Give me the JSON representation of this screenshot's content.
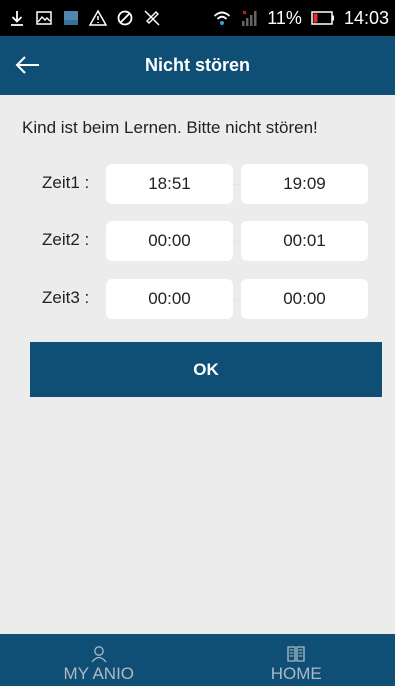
{
  "status": {
    "battery": "11%",
    "time": "14:03",
    "icons": [
      "download-icon",
      "image-icon",
      "app-icon",
      "warning-icon",
      "data-saver-icon",
      "mute-icon",
      "wifi-icon",
      "signal-icon",
      "battery-icon"
    ]
  },
  "header": {
    "title": "Nicht stören",
    "back_icon": "arrow-left-icon"
  },
  "message": "Kind ist beim Lernen. Bitte nicht stören!",
  "rows": [
    {
      "label": "Zeit1 :",
      "start": "18:51",
      "end": "19:09"
    },
    {
      "label": "Zeit2 :",
      "start": "00:00",
      "end": "00:01"
    },
    {
      "label": "Zeit3 :",
      "start": "00:00",
      "end": "00:00"
    }
  ],
  "ok_label": "OK",
  "nav": [
    {
      "label": "MY ANIO",
      "icon": "person-icon"
    },
    {
      "label": "HOME",
      "icon": "book-icon"
    }
  ],
  "colors": {
    "primary": "#0f4f75",
    "background": "#ececec",
    "nav_text": "#aeb9c3"
  }
}
